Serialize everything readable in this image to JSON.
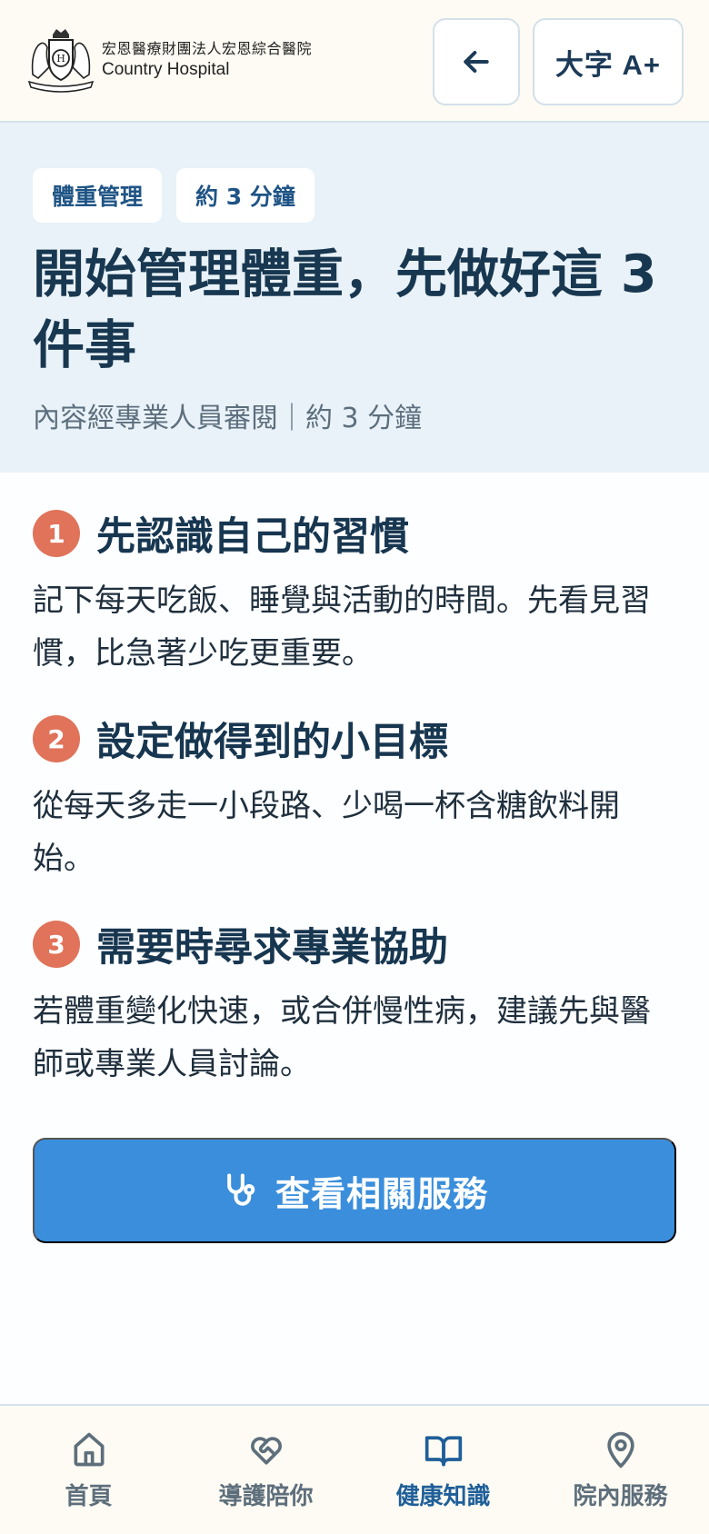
{
  "header": {
    "brand_cn": "宏恩醫療財團法人宏恩綜合醫院",
    "brand_en": "Country Hospital",
    "back_icon": "arrow-left-icon",
    "font_size_label": "大字 A+"
  },
  "article": {
    "tags": [
      "體重管理",
      "約 3 分鐘"
    ],
    "title": "開始管理體重，先做好這 3 件事",
    "meta": "內容經專業人員審閱｜約 3 分鐘",
    "steps": [
      {
        "number": "1",
        "title": "先認識自己的習慣",
        "body": "記下每天吃飯、睡覺與活動的時間。先看見習慣，比急著少吃更重要。"
      },
      {
        "number": "2",
        "title": "設定做得到的小目標",
        "body": "從每天多走一小段路、少喝一杯含糖飲料開始。"
      },
      {
        "number": "3",
        "title": "需要時尋求專業協助",
        "body": "若體重變化快速，或合併慢性病，建議先與醫師或專業人員討論。"
      }
    ]
  },
  "cta": {
    "label": "查看相關服務",
    "icon": "stethoscope-icon"
  },
  "nav": {
    "items": [
      {
        "label": "首頁",
        "icon": "home-icon",
        "active": false
      },
      {
        "label": "導護陪你",
        "icon": "heart-handshake-icon",
        "active": false
      },
      {
        "label": "健康知識",
        "icon": "book-open-icon",
        "active": true
      },
      {
        "label": "院內服務",
        "icon": "map-pin-icon",
        "active": false
      }
    ]
  },
  "colors": {
    "accent": "#3a8edc",
    "step_badge": "#e0735a",
    "header_bg": "#fdfbf3",
    "hero_bg": "#e9f2f8",
    "nav_active": "#1f5f99"
  }
}
